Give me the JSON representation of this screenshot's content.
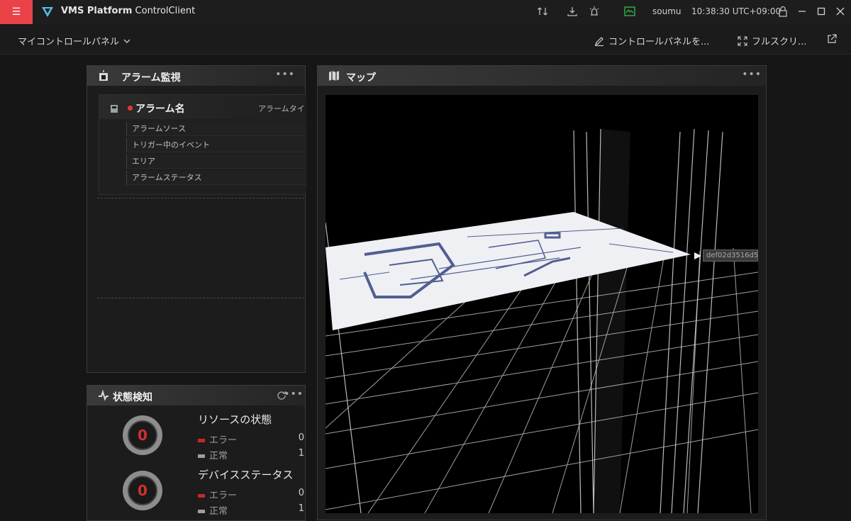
{
  "titlebar": {
    "app_title_bold": "VMS Platform",
    "app_title_rest": " ControlClient",
    "user": "soumu",
    "clock": "10:38:30 UTC+09:00",
    "menu_icon": "hamburger-icon"
  },
  "toolbar": {
    "panel_name": "マイコントロールパネル",
    "edit_label": "コントロールパネルを...",
    "fullscreen_label": "フルスクリ..."
  },
  "alarm_widget": {
    "title": "アラーム監視",
    "alarm_name": "アラーム名",
    "alarm_type": "アラームタイ",
    "fields": [
      "アラームソース",
      "トリガー中のイベント",
      "エリア",
      "アラームステータス"
    ]
  },
  "map_widget": {
    "title": "マップ",
    "device_label": "def02d3516d5"
  },
  "status_widget": {
    "title": "状態検知",
    "resource": {
      "title": "リソースの状態",
      "gauge": "0",
      "rows": [
        {
          "label": "エラー",
          "value": "0",
          "color": "#c62828"
        },
        {
          "label": "正常",
          "value": "1",
          "color": "#9e9e9e"
        }
      ]
    },
    "device": {
      "title": "デバイスステータス",
      "gauge": "0",
      "rows": [
        {
          "label": "エラー",
          "value": "0",
          "color": "#c62828"
        },
        {
          "label": "正常",
          "value": "1",
          "color": "#9e9e9e"
        }
      ]
    }
  },
  "colors": {
    "accent": "#e94349",
    "error": "#c62828",
    "logo": "#4fc3e8",
    "monitor": "#2fb34a"
  }
}
